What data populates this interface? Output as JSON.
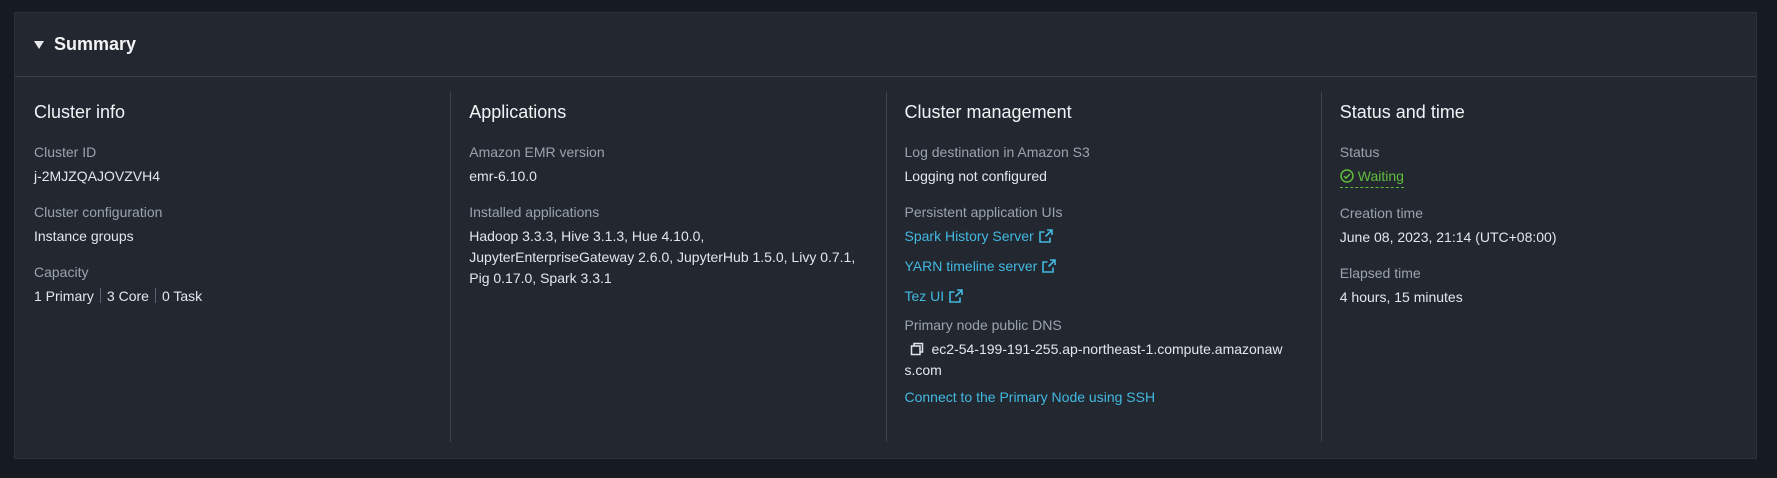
{
  "summary": {
    "title": "Summary",
    "cluster_info": {
      "heading": "Cluster info",
      "cluster_id_label": "Cluster ID",
      "cluster_id": "j-2MJZQAJOVZVH4",
      "config_label": "Cluster configuration",
      "config_value": "Instance groups",
      "capacity_label": "Capacity",
      "capacity_primary": "1 Primary",
      "capacity_core": "3 Core",
      "capacity_task": "0 Task"
    },
    "applications": {
      "heading": "Applications",
      "emr_version_label": "Amazon EMR version",
      "emr_version": "emr-6.10.0",
      "installed_label": "Installed applications",
      "installed_line1": "Hadoop 3.3.3, Hive 3.1.3, Hue 4.10.0,",
      "installed_line2": "JupyterEnterpriseGateway 2.6.0, JupyterHub 1.5.0, Livy 0.7.1,",
      "installed_line3": "Pig 0.17.0, Spark 3.3.1"
    },
    "cluster_management": {
      "heading": "Cluster management",
      "log_label": "Log destination in Amazon S3",
      "log_value": "Logging not configured",
      "persistent_label": "Persistent application UIs",
      "spark_history": "Spark History Server",
      "yarn_timeline": "YARN timeline server",
      "tez_ui": "Tez UI",
      "dns_label": "Primary node public DNS",
      "dns_line1": "ec2-54-199-191-255.ap-northeast-1.compute.amazonaw",
      "dns_line2": "s.com",
      "ssh_link": "Connect to the Primary Node using SSH"
    },
    "status_and_time": {
      "heading": "Status and time",
      "status_label": "Status",
      "status_value": "Waiting",
      "creation_label": "Creation time",
      "creation_value": "June 08, 2023, 21:14 (UTC+08:00)",
      "elapsed_label": "Elapsed time",
      "elapsed_value": "4 hours, 15 minutes"
    }
  },
  "icons": {
    "caret": "caret-down-icon",
    "external": "external-link-icon",
    "status": "check-circle-icon",
    "copy": "copy-icon"
  },
  "colors": {
    "link": "#42b8e0",
    "status_ok": "#5fbd3c",
    "panel_bg": "#232830",
    "page_bg": "#161a21"
  }
}
